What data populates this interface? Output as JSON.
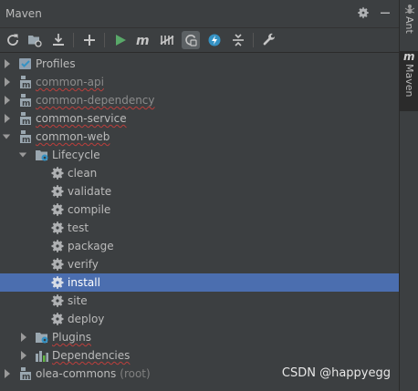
{
  "window": {
    "title": "Maven"
  },
  "toolbar": {
    "buttons": [
      "reload-icon",
      "generate-sources-icon",
      "download-icon",
      "add-icon",
      "run-icon",
      "maven-goal-icon",
      "skip-tests-icon",
      "offline-mode-icon",
      "show-dependencies-icon",
      "collapse-all-icon",
      "settings-wrench-icon"
    ]
  },
  "tree": {
    "profiles": "Profiles",
    "modules": [
      {
        "name": "common-api"
      },
      {
        "name": "common-dependency"
      },
      {
        "name": "common-service"
      },
      {
        "name": "common-web"
      }
    ],
    "lifecycle_label": "Lifecycle",
    "goals": [
      "clean",
      "validate",
      "compile",
      "test",
      "package",
      "verify",
      "install",
      "site",
      "deploy"
    ],
    "selected_goal": "install",
    "plugins": "Plugins",
    "dependencies": "Dependencies",
    "root_name": "olea-commons",
    "root_suffix": "(root)"
  },
  "side_tabs": {
    "ant": "Ant",
    "maven": "Maven"
  },
  "watermark": "CSDN @happyegg",
  "colors": {
    "background": "#3c3f41",
    "selected": "#4b6eaf",
    "text": "#bbbbbb",
    "run_green": "#59a869",
    "squiggle": "#bc3f3c"
  }
}
